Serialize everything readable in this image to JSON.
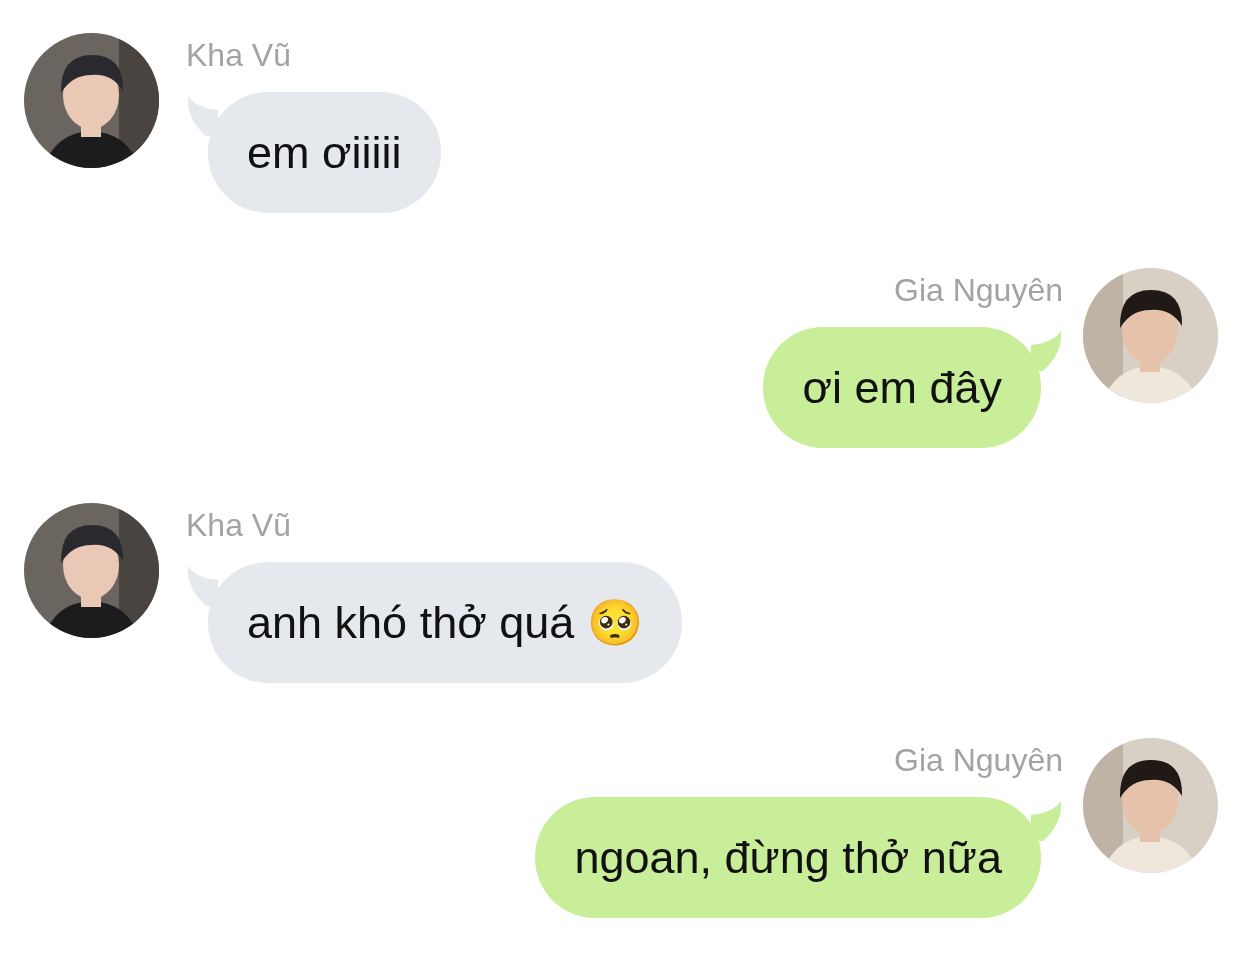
{
  "messages": [
    {
      "kind": "incoming",
      "sender": "Kha Vũ",
      "text": "em ơiiiii"
    },
    {
      "kind": "outgoing",
      "sender": "Gia Nguyên",
      "text": "ơi em đây"
    },
    {
      "kind": "incoming",
      "sender": "Kha Vũ",
      "text": "anh khó thở quá 🥺"
    },
    {
      "kind": "outgoing",
      "sender": "Gia Nguyên",
      "text": "ngoan, đừng thở nữa"
    }
  ]
}
